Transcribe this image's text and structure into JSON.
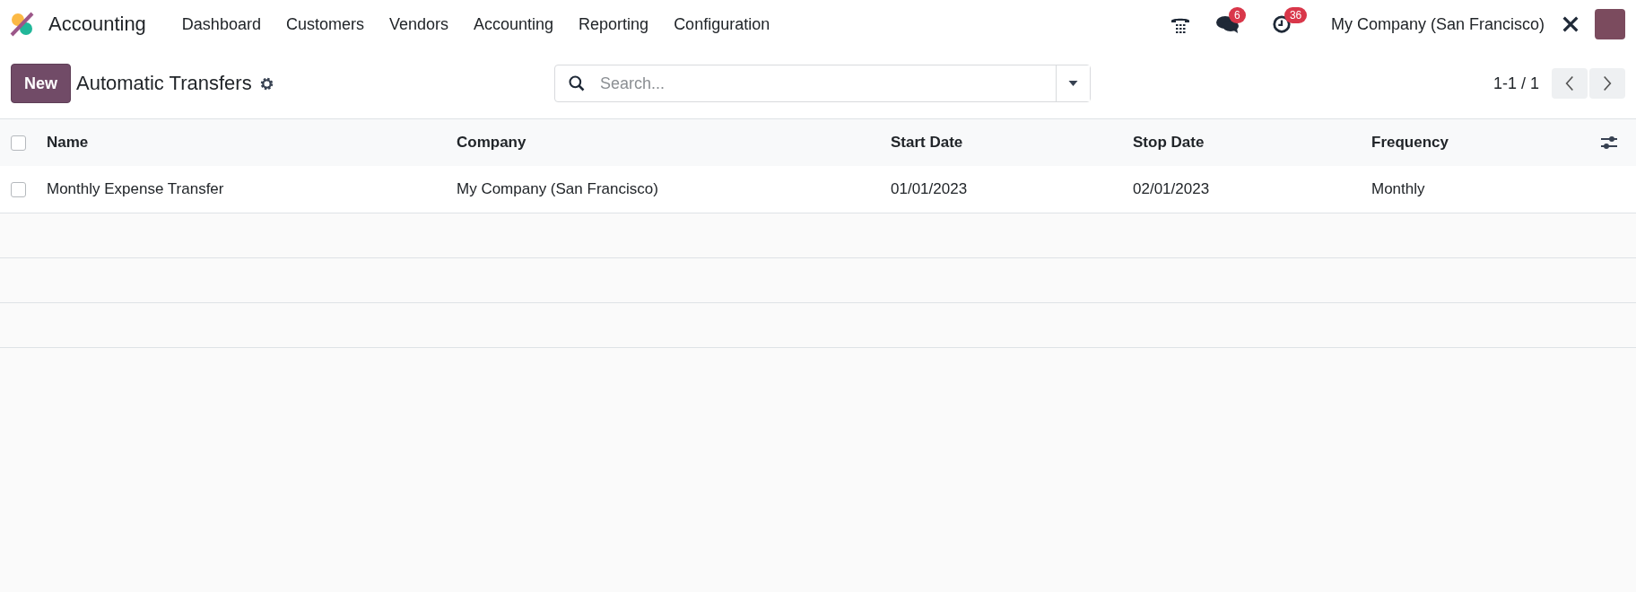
{
  "navbar": {
    "app_name": "Accounting",
    "menu": [
      "Dashboard",
      "Customers",
      "Vendors",
      "Accounting",
      "Reporting",
      "Configuration"
    ],
    "messages_badge": "6",
    "activities_badge": "36",
    "company": "My Company (San Francisco)"
  },
  "control_panel": {
    "new_button": "New",
    "title": "Automatic Transfers",
    "search": {
      "placeholder": "Search..."
    },
    "pager": "1-1 / 1"
  },
  "table": {
    "select_all_checked": false,
    "columns": [
      "Name",
      "Company",
      "Start Date",
      "Stop Date",
      "Frequency"
    ],
    "rows": [
      {
        "checked": false,
        "cells": [
          "Monthly Expense Transfer",
          "My Company (San Francisco)",
          "01/01/2023",
          "02/01/2023",
          "Monthly"
        ]
      }
    ]
  }
}
